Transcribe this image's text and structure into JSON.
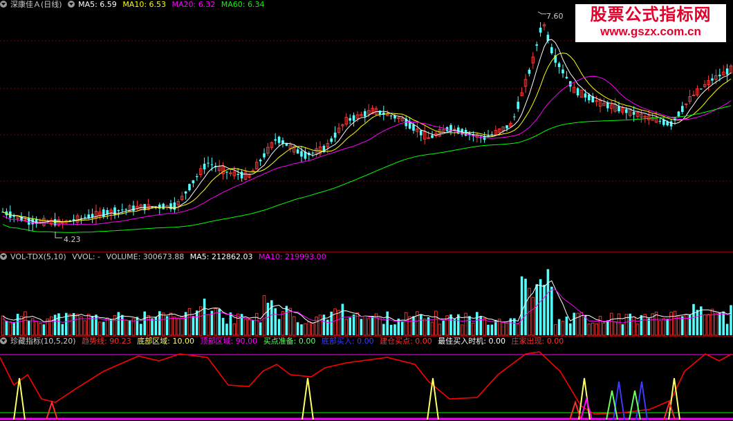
{
  "price_legend": {
    "title": "深康佳Ａ(日线)",
    "ma5": "MA5: 6.59",
    "ma10": "MA10: 6.53",
    "ma20": "MA20: 6.32",
    "ma60": "MA60: 6.34"
  },
  "price_labels": {
    "high": "7.60",
    "low": "4.23"
  },
  "vol_legend": {
    "title": "VOL-TDX(5,10)",
    "vvol": "VVOL: -",
    "volume": "VOLUME: 300673.88",
    "ma5": "MA5: 212862.03",
    "ma10": "MA10: 219993.00"
  },
  "ind_legend": {
    "title": "珍藏指标(10,5,20)",
    "trend": "趋势线: 90.23",
    "bottom": "底部区域: 10.00",
    "top": "顶部区域: 90.00",
    "prepare": "买点准备: 0.00",
    "bottom_buy": "底部买入: 0.00",
    "build": "建仓买点: 0.00",
    "best": "最佳买入时机: 0.00",
    "dealer": "庄家出现: 0.00"
  },
  "watermark": {
    "line1": "股票公式指标网",
    "line2": "www.gszx.com.cn"
  },
  "colors": {
    "up": "#ff3b3b",
    "down": "#54ffff",
    "ma5": "#ffffff",
    "ma10": "#ffff00",
    "ma20": "#ff00ff",
    "ma60": "#00ff00",
    "trend": "#ff0000"
  }
}
